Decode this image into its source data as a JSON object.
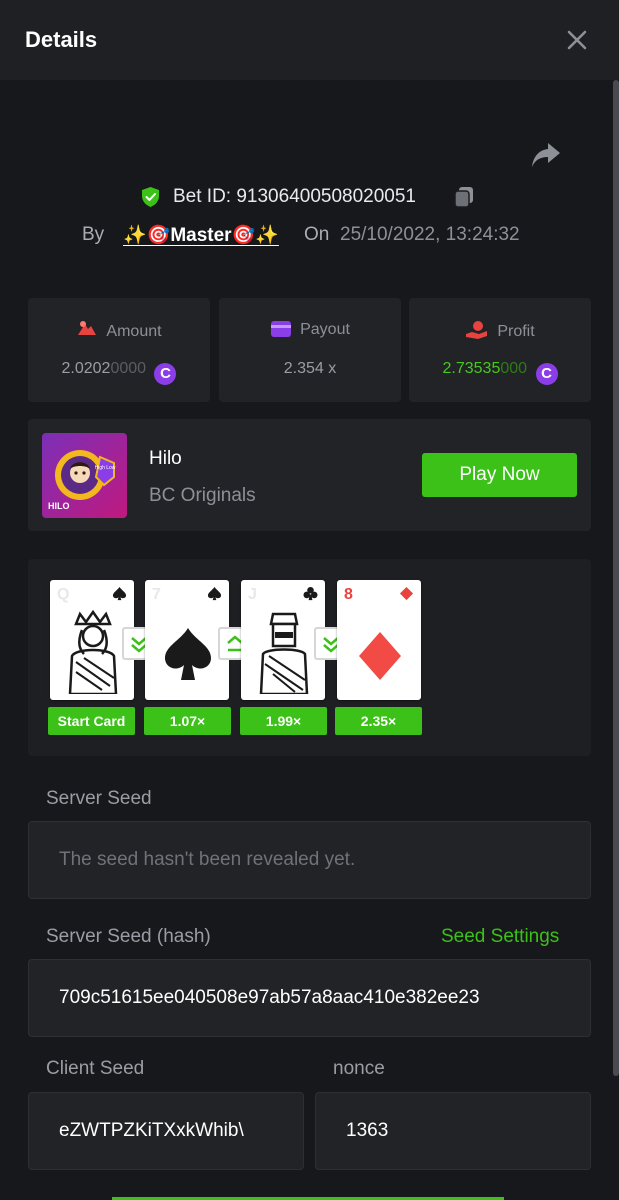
{
  "header": {
    "title": "Details",
    "close_icon": "close-icon"
  },
  "bet": {
    "id_label": "Bet ID: 913064005080200​51",
    "by_label": "By",
    "username": "✨🎯Master🎯✨",
    "on_label": "On",
    "datetime": "25/10/2022, 13:24:32"
  },
  "stats": {
    "amount": {
      "label": "Amount",
      "value_main": "2.0202",
      "value_dim": "0000",
      "coin": "C"
    },
    "payout": {
      "label": "Payout",
      "value": "2.354 x"
    },
    "profit": {
      "label": "Profit",
      "value_main": "2.73535",
      "value_dim": "000",
      "coin": "C"
    }
  },
  "game": {
    "name": "Hilo",
    "provider": "BC Originals",
    "play_label": "Play Now",
    "thumb_text": "HILO",
    "thumb_badge": "High Low"
  },
  "cards": [
    {
      "rank": "Q",
      "suit": "spade",
      "color": "#1a1a1a",
      "multiplier": "Start Card"
    },
    {
      "rank": "7",
      "suit": "spade",
      "color": "#1a1a1a",
      "multiplier": "1.07×"
    },
    {
      "rank": "J",
      "suit": "club",
      "color": "#1a1a1a",
      "multiplier": "1.99×"
    },
    {
      "rank": "8",
      "suit": "diamond",
      "color": "#e8433f",
      "multiplier": "2.35×"
    }
  ],
  "guesses": [
    "lower-or-same",
    "higher-or-same",
    "lower-or-same"
  ],
  "seeds": {
    "server_label": "Server Seed",
    "server_placeholder": "The seed hasn't been revealed yet.",
    "hash_label": "Server Seed (hash)",
    "settings_link": "Seed Settings",
    "hash_value": "709c51615ee040508e97ab57a8aac410e382ee23",
    "client_label": "Client Seed",
    "client_value": "eZWTPZKiTXxkWhib\\",
    "nonce_label": "nonce",
    "nonce_value": "1363"
  },
  "colors": {
    "accent": "#3bc117",
    "coin": "#8b3ee8",
    "panel": "#222327",
    "background": "#17181b"
  }
}
